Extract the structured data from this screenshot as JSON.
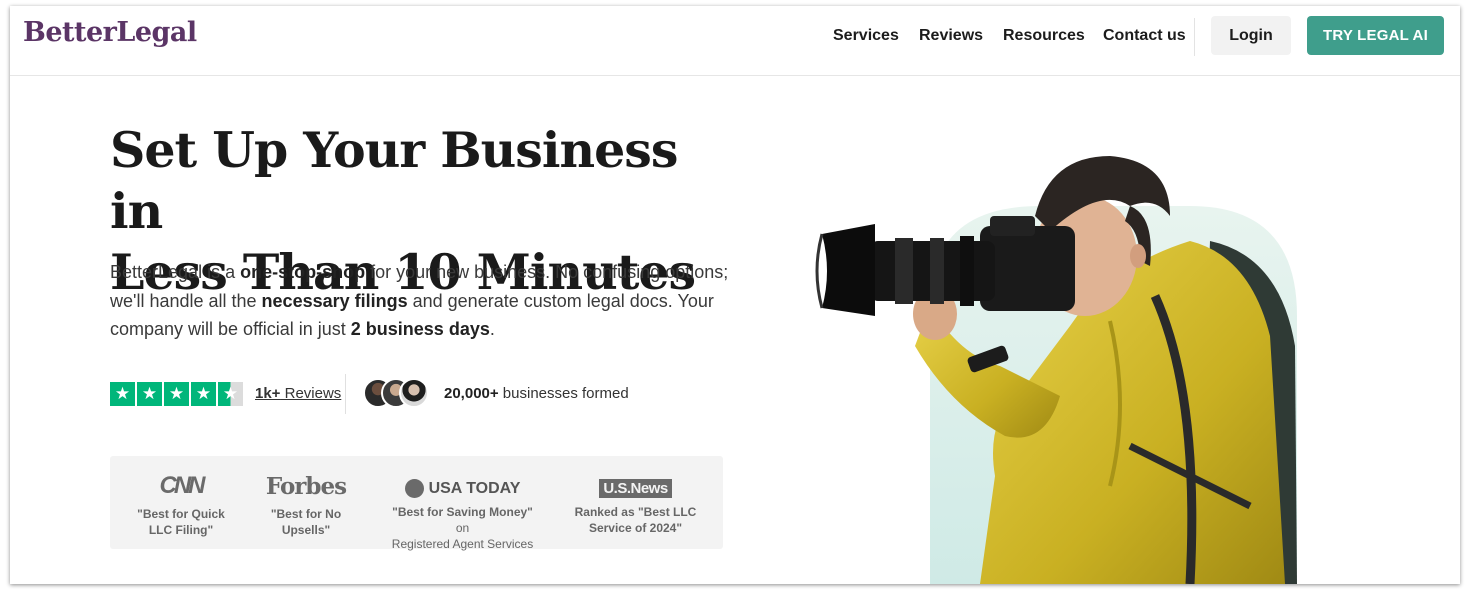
{
  "brand": {
    "logo": "BetterLegal",
    "logo_color": "#5b3566",
    "accent": "#3f9e8c"
  },
  "nav": {
    "items": [
      "Services",
      "Reviews",
      "Resources",
      "Contact us"
    ],
    "login": "Login",
    "cta": "TRY LEGAL AI"
  },
  "hero": {
    "headline_line1": "Set Up Your Business in",
    "headline_line2": "Less Than 10 Minutes",
    "intro": {
      "p1": "BetterLegal is a ",
      "b1": "one-stop-shop",
      "p2": " for your new business. No confusing options; we'll handle all the ",
      "b2": "necessary filings",
      "p3": " and generate custom legal docs. Your company will be official in just ",
      "b3": "2 business days",
      "p4": "."
    }
  },
  "social_proof": {
    "rating_stars": 4.5,
    "reviews_count": "1k+",
    "reviews_label": " Reviews",
    "businesses_count": "20,000+",
    "businesses_label": " businesses formed"
  },
  "press": [
    {
      "outlet": "CNN",
      "quote_line1": "\"Best for Quick",
      "quote_line2": "LLC Filing\""
    },
    {
      "outlet": "Forbes",
      "quote_line1": "\"Best for No",
      "quote_line2": "Upsells\""
    },
    {
      "outlet": "USA TODAY",
      "quote_bold": "\"Best for Saving Money\"",
      "quote_rest": " on",
      "quote_line2": "Registered Agent Services"
    },
    {
      "outlet": "U.S.News",
      "quote_line1": "Ranked as \"Best LLC",
      "quote_line2": "Service of 2024\""
    }
  ]
}
